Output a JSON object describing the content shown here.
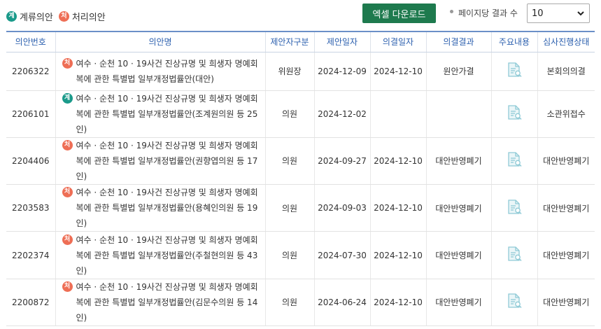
{
  "legend": {
    "gye_badge": "계",
    "gye_label": "계류의안",
    "cheo_badge": "처",
    "cheo_label": "처리의안"
  },
  "toolbar": {
    "excel_label": "엑셀 다운로드",
    "per_page_label": "페이지당 결과 수",
    "per_page_value": "10"
  },
  "colors": {
    "gye": "#1a9a8a",
    "cheo": "#ee6e55",
    "excel": "#1e7a4e",
    "header_text": "#2b5fae"
  },
  "table": {
    "headers": [
      "의안번호",
      "의안명",
      "제안자구분",
      "제안일자",
      "의결일자",
      "의결결과",
      "주요내용",
      "심사진행상태"
    ],
    "rows": [
      {
        "no": "2206322",
        "badge": "처",
        "title": "여수 · 순천 10 · 19사건 진상규명 및 희생자 명예회복에 관한 특별법 일부개정법률안(대안)",
        "proposer": "위원장",
        "proposed": "2024-12-09",
        "decided": "2024-12-10",
        "result": "원안가결",
        "status": "본회의의결"
      },
      {
        "no": "2206101",
        "badge": "계",
        "title": "여수 · 순천 10 · 19사건 진상규명 및 희생자 명예회복에 관한 특별법 일부개정법률안(조계원의원 등 25인)",
        "proposer": "의원",
        "proposed": "2024-12-02",
        "decided": "",
        "result": "",
        "status": "소관위접수"
      },
      {
        "no": "2204406",
        "badge": "처",
        "title": "여수 · 순천 10 · 19사건 진상규명 및 희생자 명예회복에 관한 특별법 일부개정법률안(권향엽의원 등 17인)",
        "proposer": "의원",
        "proposed": "2024-09-27",
        "decided": "2024-12-10",
        "result": "대안반영폐기",
        "status": "대안반영폐기"
      },
      {
        "no": "2203583",
        "badge": "처",
        "title": "여수 · 순천 10 · 19사건 진상규명 및 희생자 명예회복에 관한 특별법 일부개정법률안(용혜인의원 등 19인)",
        "proposer": "의원",
        "proposed": "2024-09-03",
        "decided": "2024-12-10",
        "result": "대안반영폐기",
        "status": "대안반영폐기"
      },
      {
        "no": "2202374",
        "badge": "처",
        "title": "여수 · 순천 10 · 19사건 진상규명 및 희생자 명예회복에 관한 특별법 일부개정법률안(주철현의원 등 43인)",
        "proposer": "의원",
        "proposed": "2024-07-30",
        "decided": "2024-12-10",
        "result": "대안반영폐기",
        "status": "대안반영폐기"
      },
      {
        "no": "2200872",
        "badge": "처",
        "title": "여수 · 순천 10 · 19사건 진상규명 및 희생자 명예회복에 관한 특별법 일부개정법률안(김문수의원 등 14인)",
        "proposer": "의원",
        "proposed": "2024-06-24",
        "decided": "2024-12-10",
        "result": "대안반영폐기",
        "status": "대안반영폐기"
      }
    ]
  }
}
